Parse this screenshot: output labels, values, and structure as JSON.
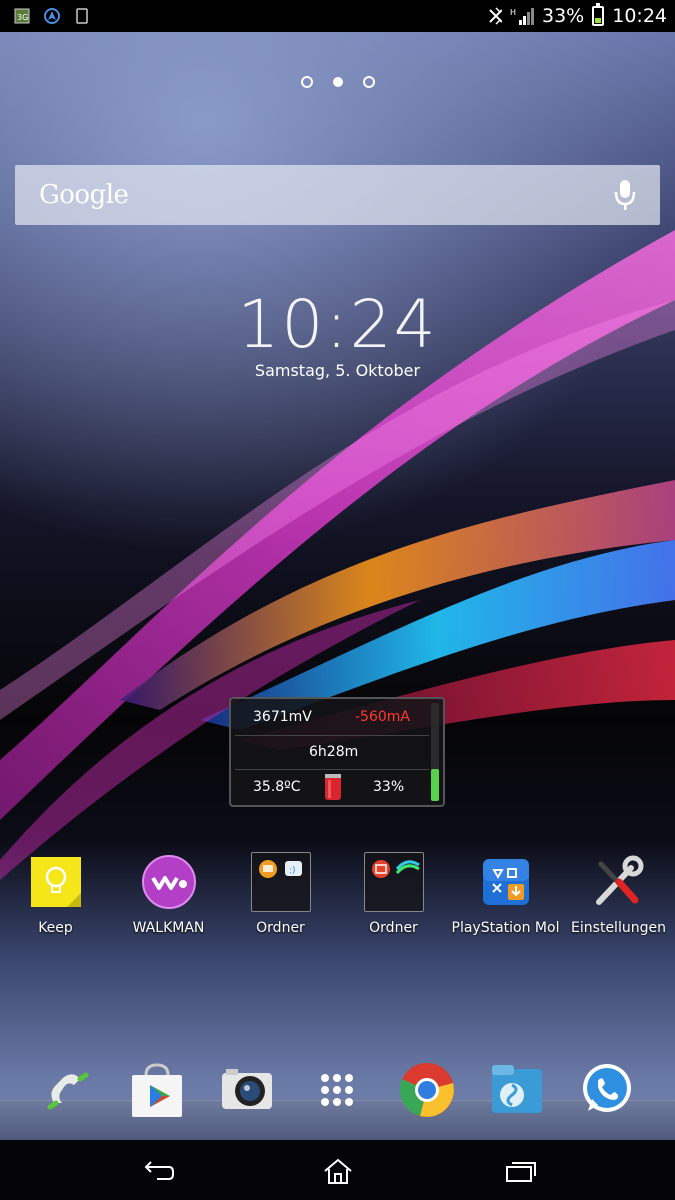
{
  "statusbar": {
    "left_icons": [
      "3g-data-icon",
      "navigation-icon",
      "device-icon"
    ],
    "right_icons": [
      "bluetooth-off-icon",
      "signal-hspa-icon"
    ],
    "battery_percent": "33%",
    "time": "10:24",
    "battery_level": 0.33
  },
  "home": {
    "pages": 3,
    "active_page": 2
  },
  "search": {
    "logo_text": "Google"
  },
  "clock_widget": {
    "time": "10:24",
    "date": "Samstag, 5. Oktober"
  },
  "battery_widget": {
    "voltage": "3671mV",
    "current": "-560mA",
    "remaining": "6h28m",
    "temperature": "35.8ºC",
    "percent": "33%",
    "level": 0.33,
    "current_color": "#ff3b30",
    "bar_color": "#58d24a"
  },
  "apps": [
    {
      "label": "Keep",
      "icon": "keep-bulb-icon"
    },
    {
      "label": "WALKMAN",
      "icon": "walkman-icon"
    },
    {
      "label": "Ordner",
      "icon": "folder-icon"
    },
    {
      "label": "Ordner",
      "icon": "folder-icon"
    },
    {
      "label": "PlayStation Mol",
      "icon": "playstation-mobile-icon"
    },
    {
      "label": "Einstellungen",
      "icon": "settings-tools-icon"
    }
  ],
  "dock": [
    {
      "icon": "phone-icon"
    },
    {
      "icon": "play-store-icon"
    },
    {
      "icon": "camera-icon"
    },
    {
      "icon": "app-drawer-icon"
    },
    {
      "icon": "chrome-icon"
    },
    {
      "icon": "file-manager-icon"
    },
    {
      "icon": "whatsapp-icon"
    }
  ],
  "navbar": {
    "buttons": [
      "back-icon",
      "home-icon",
      "recents-icon"
    ]
  }
}
